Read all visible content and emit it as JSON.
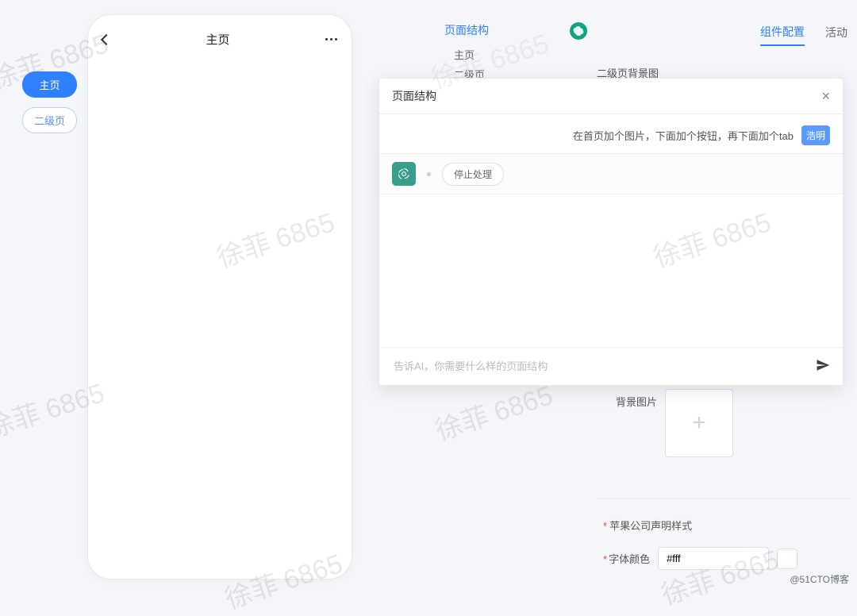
{
  "watermark": "徐菲 6865",
  "sidebar": {
    "items": [
      {
        "label": "主页",
        "active": true
      },
      {
        "label": "二级页",
        "active": false
      }
    ]
  },
  "phone": {
    "title": "主页"
  },
  "structure_panel": {
    "title": "页面结构",
    "items": [
      "主页",
      "二级页"
    ]
  },
  "right_tabs": {
    "items": [
      {
        "label": "组件配置",
        "active": true
      },
      {
        "label": "活动",
        "active": false
      }
    ]
  },
  "right_panel": {
    "header_label": "二级页背景图",
    "bg_label": "背景图片",
    "section2_title": "苹果公司声明样式",
    "font_color_label": "字体颜色",
    "font_color_value": "#fff"
  },
  "dialog": {
    "title": "页面结构",
    "user_message": "在首页加个图片，下面加个按钮，再下面加个tab",
    "user_name": "浩明",
    "stop_label": "停止处理",
    "prompt_placeholder": "告诉AI，你需要什么样的页面结构"
  },
  "attribution": "@51CTO博客"
}
